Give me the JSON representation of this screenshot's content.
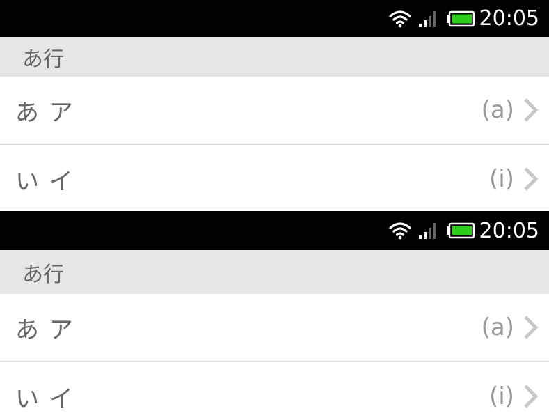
{
  "screens": [
    {
      "status": {
        "time": "20:05",
        "icons": [
          "wifi-icon",
          "signal-icon",
          "battery-icon"
        ],
        "battery_color": "#2ecc1a"
      },
      "section": {
        "title": "あ行"
      },
      "rows": [
        {
          "kana": "あ ア",
          "romaji": "(a)"
        },
        {
          "kana": "い イ",
          "romaji": "(i)"
        }
      ]
    },
    {
      "status": {
        "time": "20:05",
        "icons": [
          "wifi-icon",
          "signal-icon",
          "battery-icon"
        ],
        "battery_color": "#2ecc1a"
      },
      "section": {
        "title": "あ行"
      },
      "rows": [
        {
          "kana": "あ ア",
          "romaji": "(a)"
        },
        {
          "kana": "い イ",
          "romaji": "(i)"
        }
      ]
    }
  ]
}
